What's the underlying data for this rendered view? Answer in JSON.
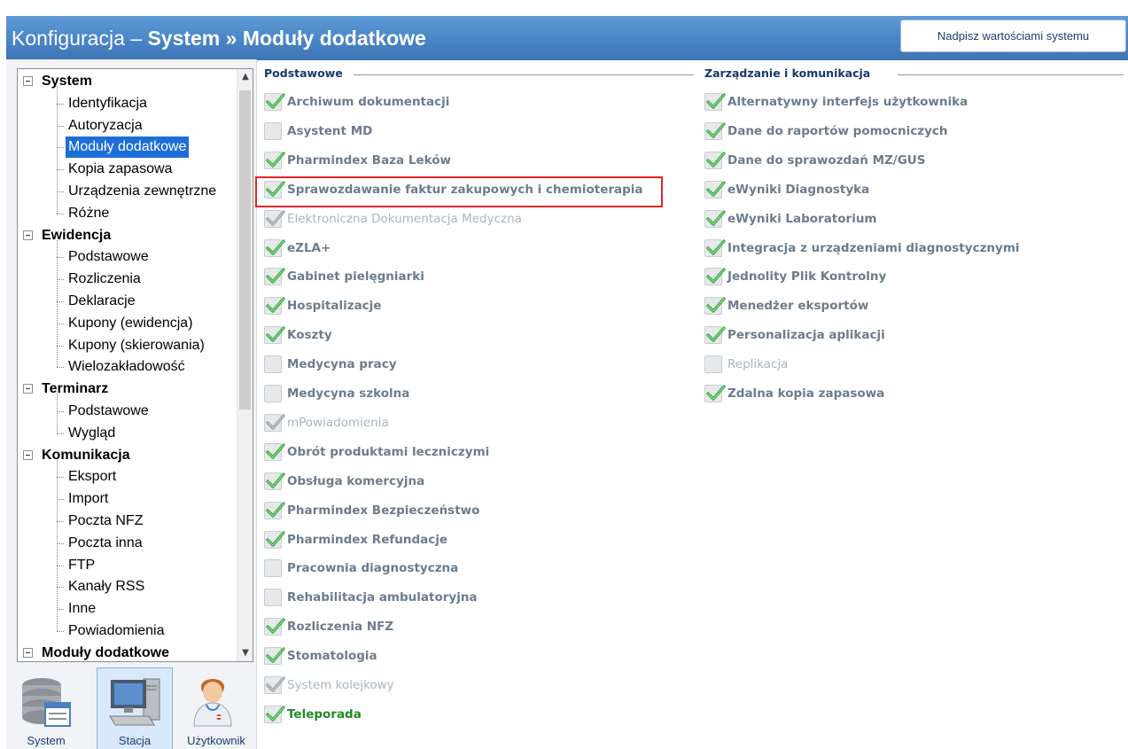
{
  "header": {
    "title_prefix": "Konfiguracja – ",
    "title_bold": "System » Moduły dodatkowe",
    "override_button": "Nadpisz wartościami systemu",
    "band_color": "#4a85c6"
  },
  "tree": {
    "rows": [
      {
        "type": "group",
        "label": "System"
      },
      {
        "type": "child",
        "label": "Identyfikacja"
      },
      {
        "type": "child",
        "label": "Autoryzacja"
      },
      {
        "type": "child",
        "label": "Moduły dodatkowe",
        "selected": true
      },
      {
        "type": "child",
        "label": "Kopia zapasowa"
      },
      {
        "type": "child",
        "label": "Urządzenia zewnętrzne"
      },
      {
        "type": "child",
        "label": "Różne"
      },
      {
        "type": "group",
        "label": "Ewidencja"
      },
      {
        "type": "child",
        "label": "Podstawowe"
      },
      {
        "type": "child",
        "label": "Rozliczenia"
      },
      {
        "type": "child",
        "label": "Deklaracje"
      },
      {
        "type": "child",
        "label": "Kupony (ewidencja)"
      },
      {
        "type": "child",
        "label": "Kupony (skierowania)"
      },
      {
        "type": "child",
        "label": "Wielozakładowość"
      },
      {
        "type": "group",
        "label": "Terminarz"
      },
      {
        "type": "child",
        "label": "Podstawowe"
      },
      {
        "type": "child",
        "label": "Wygląd"
      },
      {
        "type": "group",
        "label": "Komunikacja"
      },
      {
        "type": "child",
        "label": "Eksport"
      },
      {
        "type": "child",
        "label": "Import"
      },
      {
        "type": "child",
        "label": "Poczta NFZ"
      },
      {
        "type": "child",
        "label": "Poczta inna"
      },
      {
        "type": "child",
        "label": "FTP"
      },
      {
        "type": "child",
        "label": "Kanały RSS"
      },
      {
        "type": "child",
        "label": "Inne"
      },
      {
        "type": "child",
        "label": "Powiadomienia"
      },
      {
        "type": "group",
        "label": "Moduły dodatkowe"
      }
    ],
    "selected_color": "#1e6ed8"
  },
  "nav": [
    {
      "label": "System",
      "icon": "database-icon",
      "active": false
    },
    {
      "label": "Stacja",
      "icon": "computer-icon",
      "active": true
    },
    {
      "label": "Użytkownik",
      "icon": "doctor-user-icon",
      "active": false
    }
  ],
  "groups": {
    "basic": {
      "title": "Podstawowe",
      "items": [
        {
          "label": "Archiwum dokumentacji",
          "checked": true,
          "state": "normal"
        },
        {
          "label": "Asystent MD",
          "checked": false,
          "state": "normal"
        },
        {
          "label": "Pharmindex Baza Leków",
          "checked": true,
          "state": "normal"
        },
        {
          "label": "Sprawozdawanie faktur zakupowych i chemioterapia",
          "checked": true,
          "state": "normal",
          "highlighted": true
        },
        {
          "label": "Elektroniczna Dokumentacja Medyczna",
          "checked": true,
          "state": "disabled"
        },
        {
          "label": "eZLA+",
          "checked": true,
          "state": "normal"
        },
        {
          "label": "Gabinet pielęgniarki",
          "checked": true,
          "state": "normal"
        },
        {
          "label": "Hospitalizacje",
          "checked": true,
          "state": "normal"
        },
        {
          "label": "Koszty",
          "checked": true,
          "state": "normal"
        },
        {
          "label": "Medycyna pracy",
          "checked": false,
          "state": "normal"
        },
        {
          "label": "Medycyna szkolna",
          "checked": false,
          "state": "normal"
        },
        {
          "label": "mPowiadomienia",
          "checked": true,
          "state": "disabled"
        },
        {
          "label": "Obrót produktami leczniczymi",
          "checked": true,
          "state": "normal"
        },
        {
          "label": "Obsługa komercyjna",
          "checked": true,
          "state": "normal"
        },
        {
          "label": "Pharmindex Bezpieczeństwo",
          "checked": true,
          "state": "normal"
        },
        {
          "label": "Pharmindex Refundacje",
          "checked": true,
          "state": "normal"
        },
        {
          "label": "Pracownia diagnostyczna",
          "checked": false,
          "state": "normal"
        },
        {
          "label": "Rehabilitacja ambulatoryjna",
          "checked": false,
          "state": "normal"
        },
        {
          "label": "Rozliczenia NFZ",
          "checked": true,
          "state": "normal"
        },
        {
          "label": "Stomatologia",
          "checked": true,
          "state": "normal"
        },
        {
          "label": "System kolejkowy",
          "checked": true,
          "state": "disabled"
        },
        {
          "label": "Teleporada",
          "checked": true,
          "state": "green"
        }
      ]
    },
    "management": {
      "title": "Zarządzanie i komunikacja",
      "items": [
        {
          "label": "Alternatywny interfejs użytkownika",
          "checked": true,
          "state": "normal"
        },
        {
          "label": "Dane do raportów pomocniczych",
          "checked": true,
          "state": "normal"
        },
        {
          "label": "Dane do sprawozdań MZ/GUS",
          "checked": true,
          "state": "normal"
        },
        {
          "label": "eWyniki Diagnostyka",
          "checked": true,
          "state": "normal"
        },
        {
          "label": "eWyniki Laboratorium",
          "checked": true,
          "state": "normal"
        },
        {
          "label": "Integracja z urządzeniami diagnostycznymi",
          "checked": true,
          "state": "normal"
        },
        {
          "label": "Jednolity Plik Kontrolny",
          "checked": true,
          "state": "normal"
        },
        {
          "label": "Menedżer eksportów",
          "checked": true,
          "state": "normal"
        },
        {
          "label": "Personalizacja aplikacji",
          "checked": true,
          "state": "normal"
        },
        {
          "label": "Replikacja",
          "checked": false,
          "state": "disabled"
        },
        {
          "label": "Zdalna kopia zapasowa",
          "checked": true,
          "state": "normal"
        }
      ]
    }
  },
  "colors": {
    "check_green": "#3cb043",
    "highlight_red": "#e8232a",
    "group_title": "#16386a"
  }
}
